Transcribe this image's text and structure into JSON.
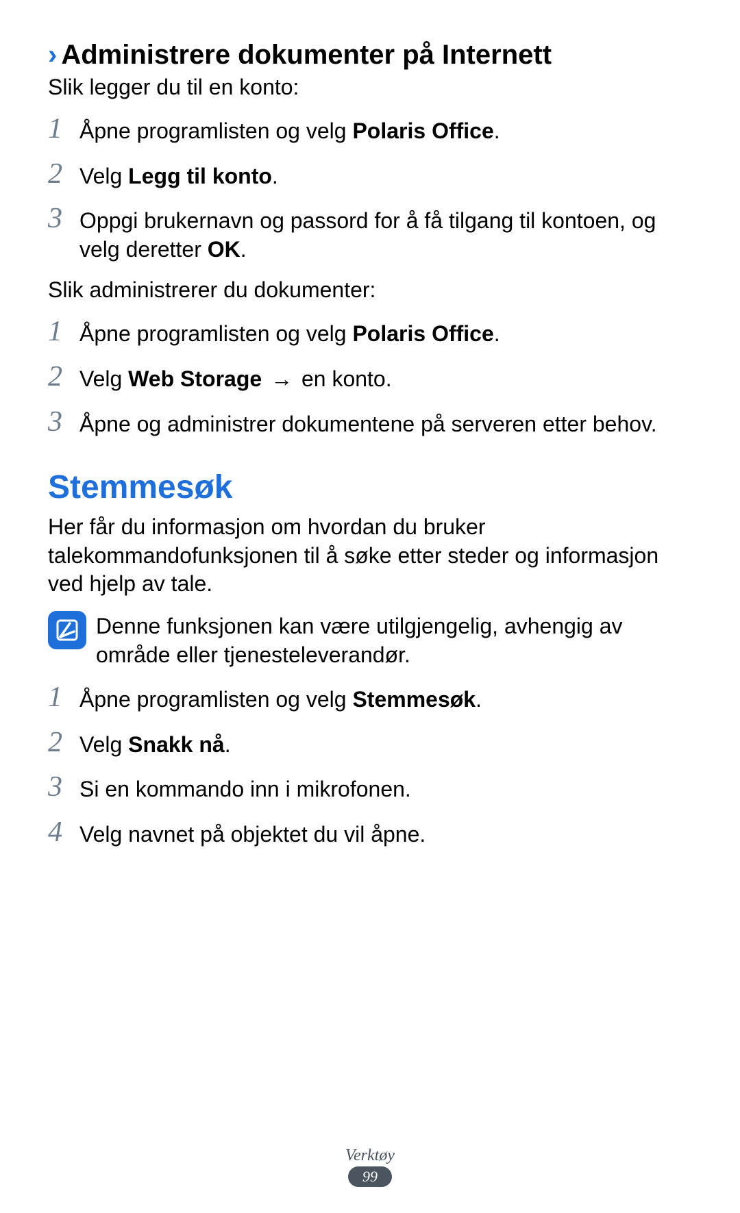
{
  "section1": {
    "heading": "Administrere dokumenter på Internett",
    "intro": "Slik legger du til en konto:",
    "stepsA": [
      {
        "pre": "Åpne programlisten og velg ",
        "bold": "Polaris Office",
        "post": "."
      },
      {
        "pre": "Velg ",
        "bold": "Legg til konto",
        "post": "."
      },
      {
        "pre": "Oppgi brukernavn og passord for å få tilgang til kontoen, og velg deretter ",
        "bold": "OK",
        "post": "."
      }
    ],
    "intro2": "Slik administrerer du dokumenter:",
    "stepsB": [
      {
        "pre": "Åpne programlisten og velg ",
        "bold": "Polaris Office",
        "post": "."
      },
      {
        "pre": "Velg ",
        "bold": "Web Storage",
        "mid": " → ",
        "post2": "en konto."
      },
      {
        "plain": "Åpne og administrer dokumentene på serveren etter behov."
      }
    ]
  },
  "section2": {
    "title": "Stemmesøk",
    "para": "Her får du informasjon om hvordan du bruker talekommandofunksjonen til å søke etter steder og informasjon ved hjelp av tale.",
    "note": "Denne funksjonen kan være utilgjengelig, avhengig av område eller tjenesteleverandør.",
    "steps": [
      {
        "pre": "Åpne programlisten og velg ",
        "bold": "Stemmesøk",
        "post": "."
      },
      {
        "pre": "Velg ",
        "bold": "Snakk nå",
        "post": "."
      },
      {
        "plain": "Si en kommando inn i mikrofonen."
      },
      {
        "plain": "Velg navnet på objektet du vil åpne."
      }
    ]
  },
  "footer": {
    "label": "Verktøy",
    "page": "99"
  },
  "nums": [
    "1",
    "2",
    "3",
    "4"
  ]
}
